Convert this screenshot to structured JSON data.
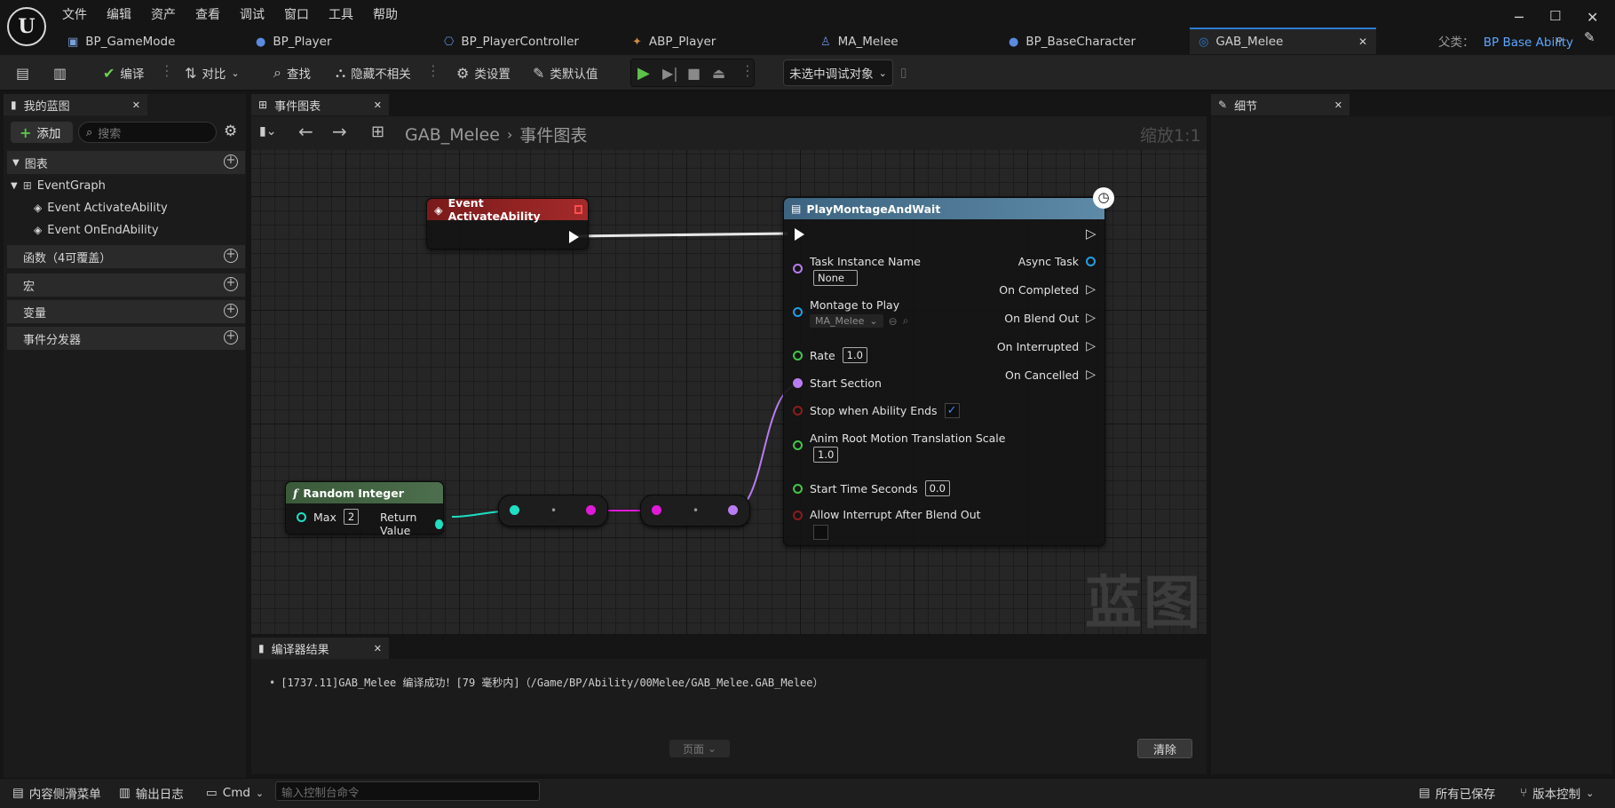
{
  "menu": [
    "文件",
    "编辑",
    "资产",
    "查看",
    "调试",
    "窗口",
    "工具",
    "帮助"
  ],
  "asset_tabs": [
    {
      "label": "BP_GameMode",
      "icon": "gamemode-icon"
    },
    {
      "label": "BP_Player",
      "icon": "pawn-icon"
    },
    {
      "label": "BP_PlayerController",
      "icon": "controller-icon"
    },
    {
      "label": "ABP_Player",
      "icon": "anim-bp-icon"
    },
    {
      "label": "MA_Melee",
      "icon": "montage-icon"
    },
    {
      "label": "BP_BaseCharacter",
      "icon": "pawn-icon"
    },
    {
      "label": "GAB_Melee",
      "icon": "ability-icon"
    }
  ],
  "parent_class": {
    "label": "父类：",
    "value": "BP Base Ability"
  },
  "toolbar": {
    "compile": "编译",
    "diff": "对比",
    "find": "查找",
    "hide_unrelated": "隐藏不相关",
    "class_settings": "类设置",
    "class_defaults": "类默认值",
    "debug_target": "未选中调试对象"
  },
  "my_blueprint": {
    "tab": "我的蓝图",
    "add": "添加",
    "search_placeholder": "搜索",
    "graphs": "图表",
    "event_graph": "EventGraph",
    "events": [
      "Event ActivateAbility",
      "Event OnEndAbility"
    ],
    "functions": "函数（4可覆盖）",
    "macros": "宏",
    "variables": "变量",
    "dispatchers": "事件分发器"
  },
  "graph": {
    "tab": "事件图表",
    "breadcrumb_root": "GAB_Melee",
    "breadcrumb_current": "事件图表",
    "zoom": "缩放1:1",
    "watermark": "蓝图",
    "event_node": {
      "title": "Event ActivateAbility"
    },
    "random_node": {
      "title": "Random Integer",
      "max_label": "Max",
      "max_value": "2",
      "return_label": "Return Value"
    },
    "play_node": {
      "title": "PlayMontageAndWait",
      "inputs": {
        "task_instance_name": "Task Instance Name",
        "task_instance_value": "None",
        "montage": "Montage to Play",
        "montage_value": "MA_Melee",
        "rate": "Rate",
        "rate_value": "1.0",
        "start_section": "Start Section",
        "stop_when_ends": "Stop when Ability Ends",
        "anim_root": "Anim Root Motion Translation Scale",
        "anim_root_value": "1.0",
        "start_time": "Start Time Seconds",
        "start_time_value": "0.0",
        "allow_interrupt": "Allow Interrupt After Blend Out"
      },
      "outputs": {
        "async_task": "Async Task",
        "on_completed": "On Completed",
        "on_blend_out": "On Blend Out",
        "on_interrupted": "On Interrupted",
        "on_cancelled": "On Cancelled"
      },
      "stop_when_ends_checked": true,
      "allow_interrupt_checked": false
    }
  },
  "compiler": {
    "tab": "编译器结果",
    "message": "[1737.11]GAB_Melee 编译成功！[79 毫秒内]（/Game/BP/Ability/00Melee/GAB_Melee.GAB_Melee）",
    "page": "页面",
    "clear": "清除"
  },
  "details": {
    "tab": "细节"
  },
  "statusbar": {
    "content_drawer": "内容侧滑菜单",
    "output_log": "输出日志",
    "cmd": "Cmd",
    "cmd_placeholder": "输入控制台命令",
    "all_saved": "所有已保存",
    "source_control": "版本控制"
  },
  "colors": {
    "accent": "#2d7bd1",
    "event_header": "#8e1d1d",
    "function_header": "#3d5a3d",
    "latent_header": "#3f6680",
    "pin_name": "#b97cf0",
    "pin_object": "#1fa0e6",
    "pin_float": "#43c64a",
    "pin_bool": "#8a1c1c",
    "pin_int": "#1edfc3",
    "wire_int": "#1edfc3",
    "wire_name": "#e01ad9"
  }
}
